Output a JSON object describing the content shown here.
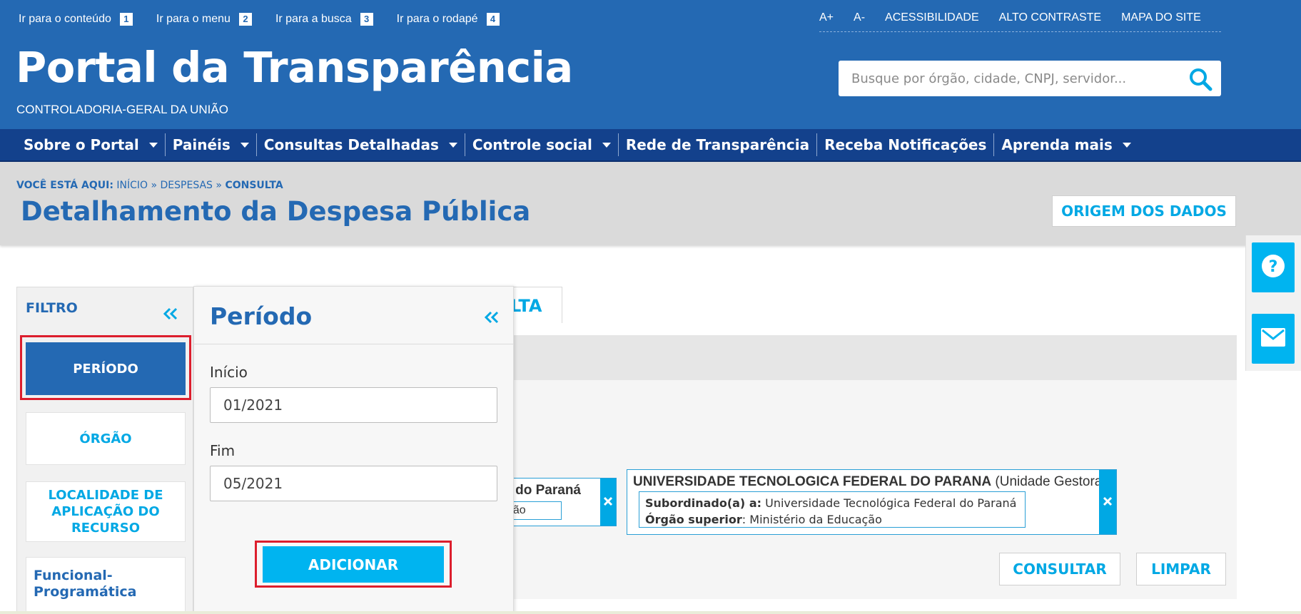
{
  "skip_links": [
    {
      "label": "Ir para o conteúdo",
      "key": "1"
    },
    {
      "label": "Ir para o menu",
      "key": "2"
    },
    {
      "label": "Ir para a busca",
      "key": "3"
    },
    {
      "label": "Ir para o rodapé",
      "key": "4"
    }
  ],
  "utility": {
    "font_up": "A+",
    "font_down": "A-",
    "accessibility": "ACESSIBILIDADE",
    "high_contrast": "ALTO CONTRASTE",
    "sitemap": "MAPA DO SITE"
  },
  "brand": {
    "title": "Portal da Transparência",
    "subtitle": "CONTROLADORIA-GERAL DA UNIÃO"
  },
  "search": {
    "placeholder": "Busque por órgão, cidade, CNPJ, servidor...",
    "icon": "search-icon"
  },
  "nav": [
    {
      "label": "Sobre o Portal",
      "dropdown": true
    },
    {
      "label": "Painéis",
      "dropdown": true
    },
    {
      "label": "Consultas Detalhadas",
      "dropdown": true
    },
    {
      "label": "Controle social",
      "dropdown": true
    },
    {
      "label": "Rede de Transparência",
      "dropdown": false
    },
    {
      "label": "Receba Notificações",
      "dropdown": false
    },
    {
      "label": "Aprenda mais",
      "dropdown": true
    }
  ],
  "breadcrumb": {
    "prefix": "VOCÊ ESTÁ AQUI:",
    "items": [
      "INÍCIO",
      "DESPESAS",
      "CONSULTA"
    ],
    "separator": "»"
  },
  "page": {
    "title": "Detalhamento da Despesa Pública",
    "origin_button": "ORIGEM DOS DADOS"
  },
  "floating": {
    "help_icon": "question-icon",
    "mail_icon": "envelope-icon"
  },
  "main": {
    "consulta_tab_partial": "LTA",
    "chip1": {
      "title_partial": "al do Paraná",
      "sub_partial": "ação"
    },
    "chip2": {
      "name": "UNIVERSIDADE TECNOLOGICA FEDERAL DO PARANA",
      "type": "(Unidade Gestora)",
      "sub_label": "Subordinado(a) a:",
      "sub_value": "Universidade Tecnológica Federal do Paraná",
      "org_label": "Órgão superior",
      "org_value": ": Ministério da Educação"
    },
    "consultar": "CONSULTAR",
    "limpar": "LIMPAR"
  },
  "filter": {
    "title": "FILTRO",
    "items": [
      {
        "label": "PERÍODO",
        "active": true
      },
      {
        "label": "ÓRGÃO",
        "active": false
      },
      {
        "label": "LOCALIDADE DE APLICAÇÃO DO RECURSO",
        "active": false
      }
    ],
    "funcional": "Funcional-Programática"
  },
  "periodo": {
    "title": "Período",
    "inicio_label": "Início",
    "inicio_value": "01/2021",
    "fim_label": "Fim",
    "fim_value": "05/2021",
    "add_button": "ADICIONAR"
  },
  "colors": {
    "header_blue": "#2469b3",
    "nav_blue": "#13418c",
    "accent_cyan": "#00b4f0",
    "highlight_red": "#dc1e2d"
  }
}
